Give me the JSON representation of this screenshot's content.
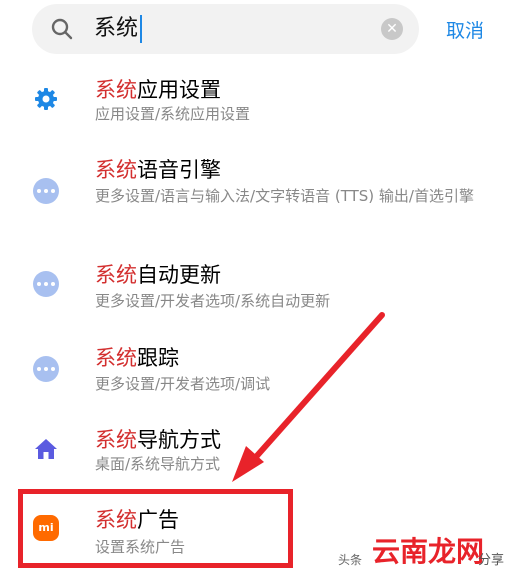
{
  "search": {
    "query": "系统",
    "cancel_label": "取消"
  },
  "results": [
    {
      "title_highlight": "系统",
      "title_rest": "应用设置",
      "path": "应用设置/系统应用设置",
      "icon": "gear-icon"
    },
    {
      "title_highlight": "系统",
      "title_rest": "语音引擎",
      "path": "更多设置/语言与输入法/文字转语音 (TTS) 输出/首选引擎",
      "icon": "more-dots-icon"
    },
    {
      "title_highlight": "系统",
      "title_rest": "自动更新",
      "path": "更多设置/开发者选项/系统自动更新",
      "icon": "more-dots-icon"
    },
    {
      "title_highlight": "系统",
      "title_rest": "跟踪",
      "path": "更多设置/开发者选项/调试",
      "icon": "more-dots-icon"
    },
    {
      "title_highlight": "系统",
      "title_rest": "导航方式",
      "path": "桌面/系统导航方式",
      "icon": "home-icon"
    },
    {
      "title_highlight": "系统",
      "title_rest": "广告",
      "path": "设置系统广告",
      "icon": "mi-icon"
    }
  ],
  "mi_icon_text": "mi",
  "watermark": {
    "logo": "云南龙网",
    "caption": "分享",
    "small_text": "头条"
  },
  "colors": {
    "accent": "#1e88e5",
    "highlight_red": "#d32f2f",
    "annotation_red": "#e8232a",
    "mi_orange": "#ff6a00",
    "dots_blue": "#a8c0f0",
    "home_purple": "#5b5be0"
  }
}
